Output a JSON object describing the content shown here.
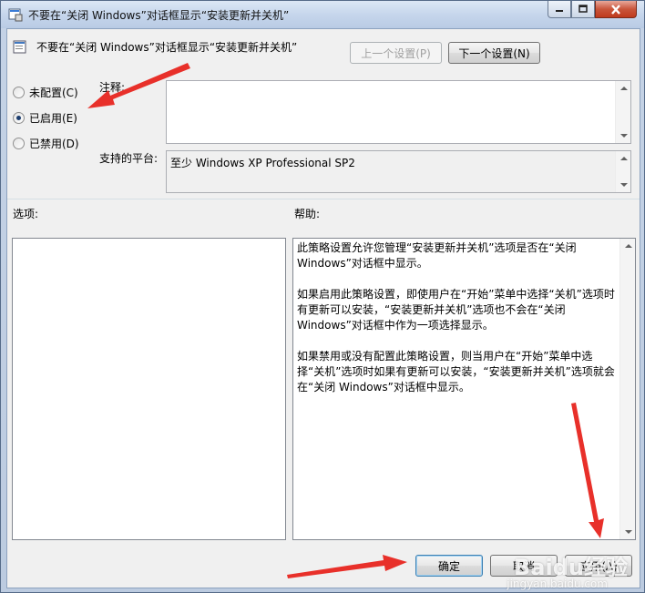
{
  "window": {
    "title": "不要在“关闭 Windows”对话框显示“安装更新并关机”"
  },
  "header": {
    "policy_name": "不要在“关闭 Windows”对话框显示“安装更新并关机”",
    "prev_button": "上一个设置(P)",
    "next_button": "下一个设置(N)"
  },
  "state_options": [
    {
      "label": "未配置(C)",
      "checked": false
    },
    {
      "label": "已启用(E)",
      "checked": true
    },
    {
      "label": "已禁用(D)",
      "checked": false
    }
  ],
  "comment": {
    "label": "注释:",
    "value": ""
  },
  "platform": {
    "label": "支持的平台:",
    "value": "至少 Windows XP Professional SP2"
  },
  "options_label": "选项:",
  "help": {
    "label": "帮助:",
    "paragraphs": [
      "此策略设置允许您管理“安装更新并关机”选项是否在“关闭 Windows”对话框中显示。",
      "如果启用此策略设置，即使用户在“开始”菜单中选择“关机”选项时有更新可以安装，“安装更新并关机”选项也不会在“关闭 Windows”对话框中作为一项选择显示。",
      "如果禁用或没有配置此策略设置，则当用户在“开始”菜单中选择“关机”选项时如果有更新可以安装，“安装更新并关机”选项就会在“关闭 Windows”对话框中显示。"
    ]
  },
  "footer": {
    "ok": "确定",
    "cancel": "取消",
    "apply": "应用(A)"
  },
  "watermark": {
    "text": "Baidu经验",
    "sub": "jingyan.baidu.com"
  },
  "colors": {
    "annotation_arrow": "#e8302a",
    "close_button": "#c9553b"
  }
}
